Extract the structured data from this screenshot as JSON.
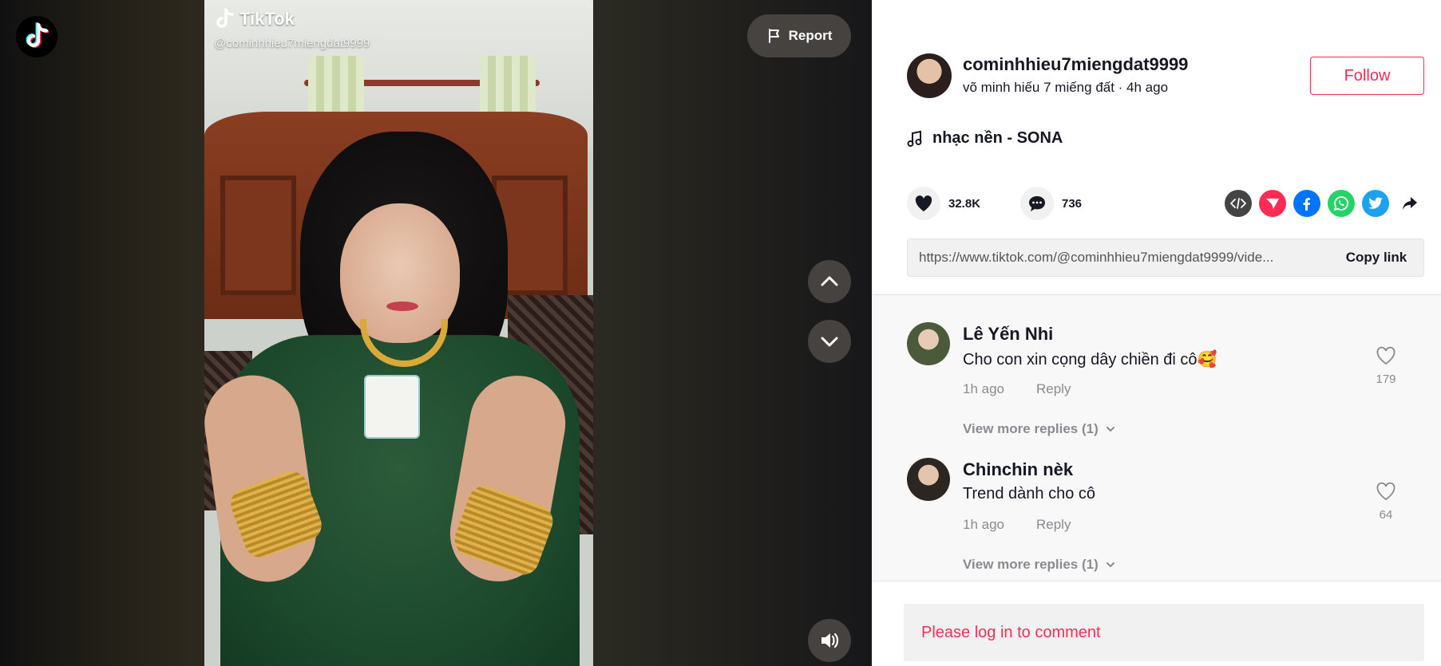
{
  "video": {
    "watermark_brand": "TikTok",
    "watermark_user": "@cominhhieu7miengdat9999",
    "report_label": "Report"
  },
  "author": {
    "username": "cominhhieu7miengdat9999",
    "subtitle": "võ minh hiếu 7 miếng đất · 4h ago",
    "follow_label": "Follow"
  },
  "music": {
    "title": "nhạc nền - SONA"
  },
  "stats": {
    "likes": "32.8K",
    "comments": "736"
  },
  "share": {
    "icons": [
      "embed-icon",
      "send-icon",
      "facebook-icon",
      "whatsapp-icon",
      "twitter-icon",
      "share-arrow-icon"
    ],
    "colors": {
      "embed": "#444444",
      "send": "#fe2c55",
      "facebook": "#0075fa",
      "whatsapp": "#25d366",
      "twitter": "#1da1f2"
    }
  },
  "link": {
    "url": "https://www.tiktok.com/@cominhhieu7miengdat9999/vide...",
    "copy_label": "Copy link"
  },
  "comments": [
    {
      "name": "Lê Yến Nhi",
      "text": "Cho con xin cọng dây chiền đi cô🥰",
      "time": "1h ago",
      "reply_label": "Reply",
      "likes": "179",
      "more_replies": "View more replies (1)"
    },
    {
      "name": "Chinchin nèk",
      "text": "Trend dành cho cô",
      "time": "1h ago",
      "reply_label": "Reply",
      "likes": "64",
      "more_replies": "View more replies (1)"
    }
  ],
  "login_prompt": "Please log in to comment",
  "colors": {
    "accent": "#fe2c55",
    "text": "#161823",
    "muted": "#8a8b91"
  }
}
